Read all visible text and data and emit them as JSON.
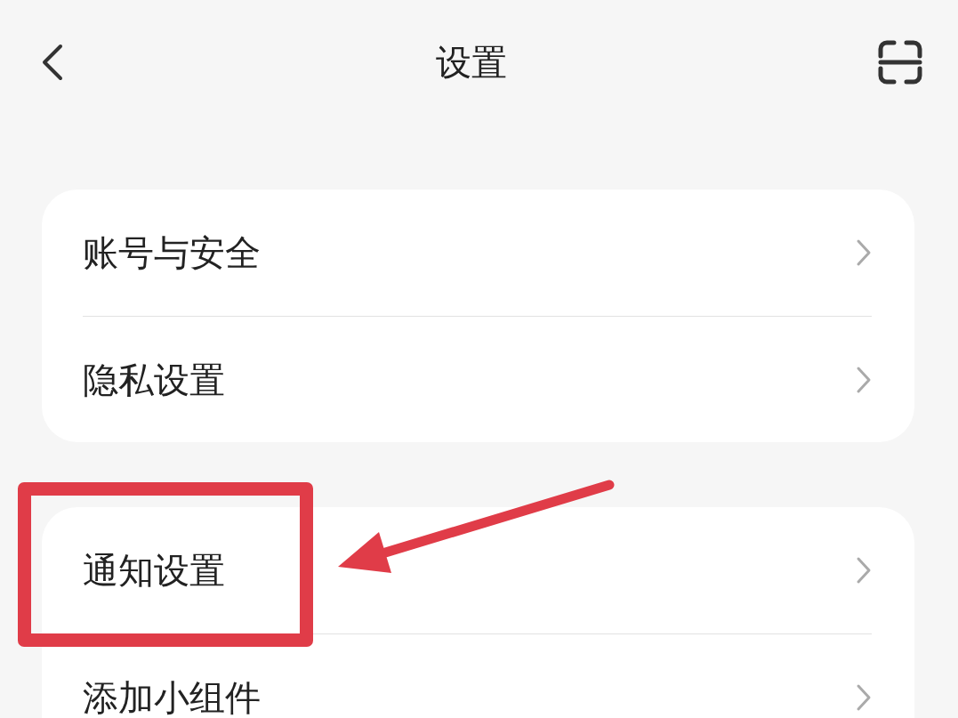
{
  "header": {
    "title": "设置"
  },
  "groups": [
    {
      "items": [
        {
          "label": "账号与安全",
          "highlighted": false
        },
        {
          "label": "隐私设置",
          "highlighted": false
        }
      ]
    },
    {
      "items": [
        {
          "label": "通知设置",
          "highlighted": true
        },
        {
          "label": "添加小组件",
          "highlighted": false
        }
      ]
    }
  ]
}
